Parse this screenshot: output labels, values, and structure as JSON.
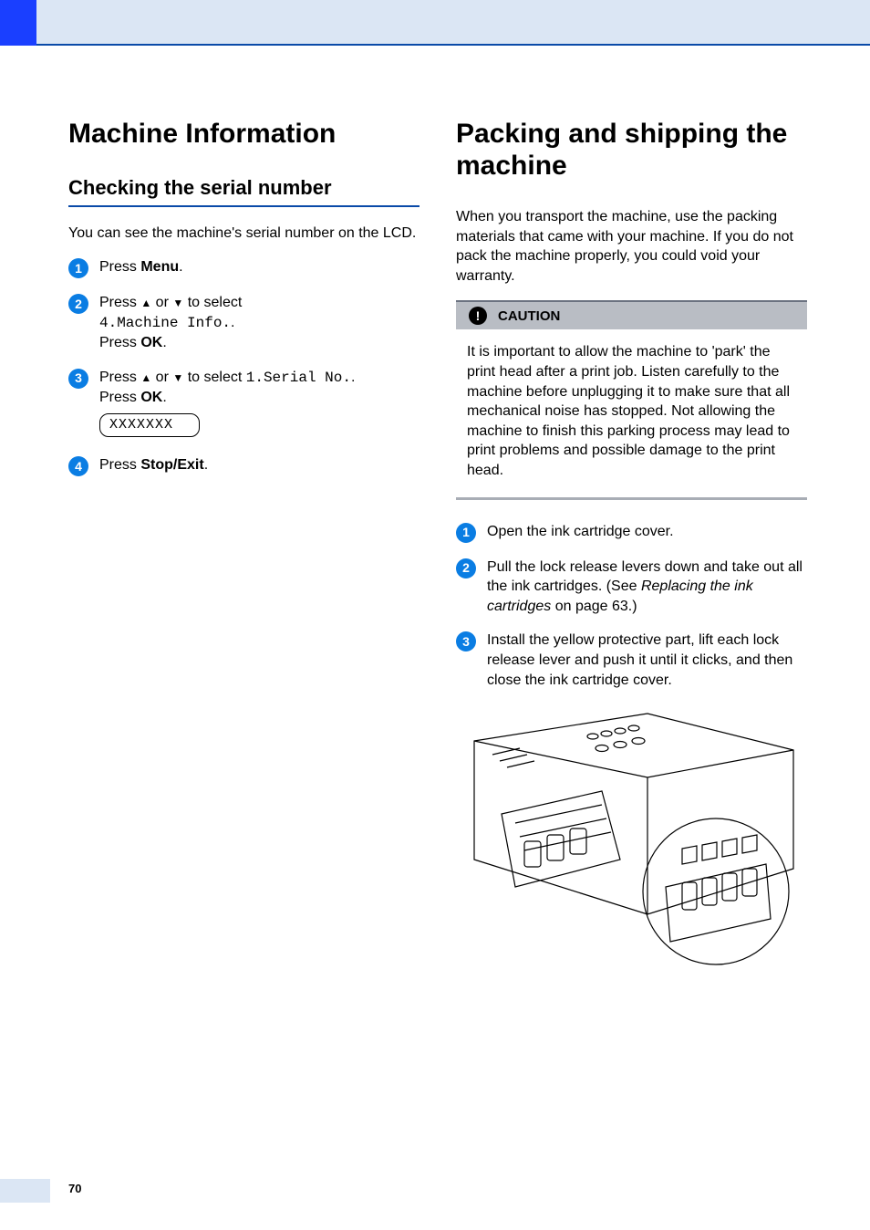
{
  "pageNumber": "70",
  "left": {
    "h1": "Machine Information",
    "h2": "Checking the serial number",
    "intro": "You can see the machine's serial number on the LCD.",
    "steps": {
      "s1": {
        "num": "1",
        "a": "Press ",
        "b": "Menu",
        "c": "."
      },
      "s2": {
        "num": "2",
        "a": "Press ",
        "b": " or ",
        "c": " to select",
        "mono": "4.Machine Info.",
        "d": ".",
        "e": "Press ",
        "f": "OK",
        "g": "."
      },
      "s3": {
        "num": "3",
        "a": "Press ",
        "b": " or ",
        "c": " to select ",
        "mono": "1.Serial No.",
        "d": ".",
        "e": "Press ",
        "f": "OK",
        "g": ".",
        "lcd": "XXXXXXX"
      },
      "s4": {
        "num": "4",
        "a": "Press ",
        "b": "Stop/Exit",
        "c": "."
      }
    }
  },
  "right": {
    "h1": "Packing and shipping the machine",
    "intro": "When you transport the machine, use the packing materials that came with your machine. If you do not pack the machine properly, you could void your warranty.",
    "caution": {
      "label": "CAUTION",
      "body": "It is important to allow the machine to 'park' the print head after a print job. Listen carefully to the machine before unplugging it to make sure that all mechanical noise has stopped. Not allowing the machine to finish this parking process may lead to print problems and possible damage to the print head."
    },
    "steps": {
      "s1": {
        "num": "1",
        "text": "Open the ink cartridge cover."
      },
      "s2": {
        "num": "2",
        "a": "Pull the lock release levers down and take out all the ink cartridges. (See ",
        "italic": "Replacing the ink cartridges",
        "b": " on page 63.)"
      },
      "s3": {
        "num": "3",
        "text": "Install the yellow protective part, lift each lock release lever and push it until it clicks, and then close the ink cartridge cover."
      }
    }
  }
}
